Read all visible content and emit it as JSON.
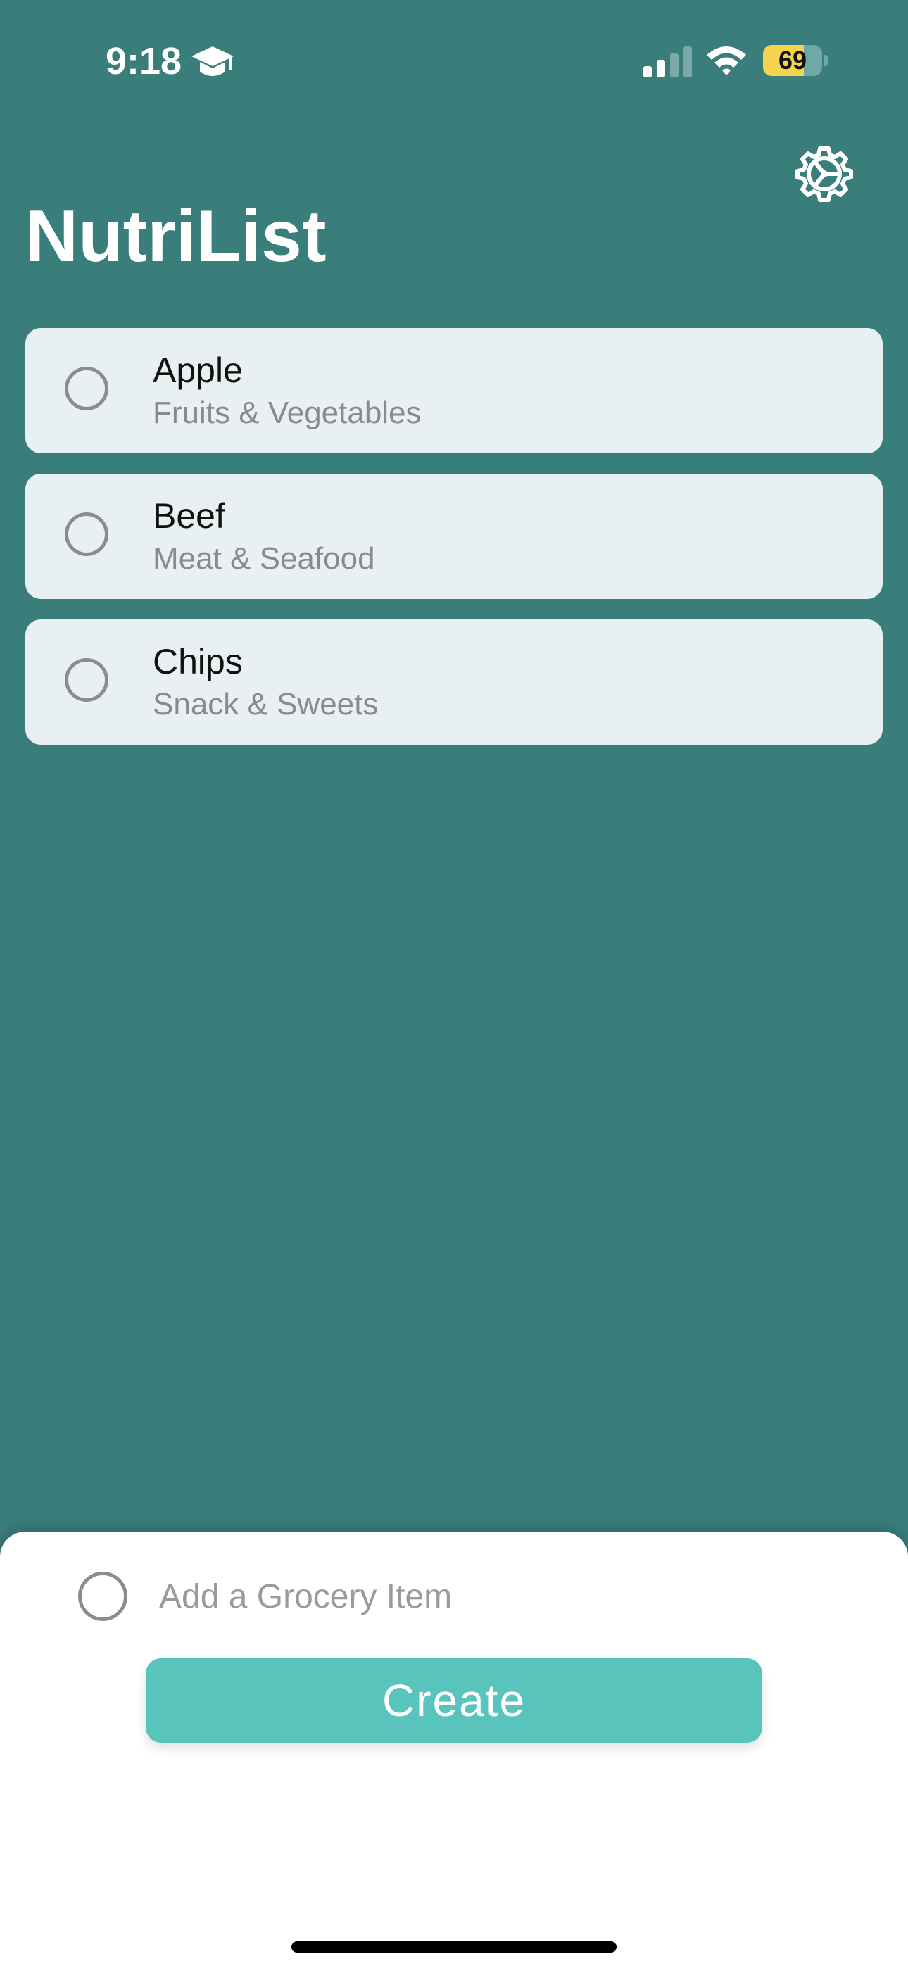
{
  "status_bar": {
    "time": "9:18",
    "focus_icon": "graduation-cap-icon",
    "signal_icon": "cellular-signal-icon",
    "wifi_icon": "wifi-icon",
    "battery_percent": "69",
    "battery_level": 0.69,
    "battery_color": "#f5d34f"
  },
  "header": {
    "title": "NutriList",
    "settings_icon": "gear-icon"
  },
  "grocery_items": [
    {
      "name": "Apple",
      "category": "Fruits & Vegetables"
    },
    {
      "name": "Beef",
      "category": "Meat & Seafood"
    },
    {
      "name": "Chips",
      "category": "Snack & Sweets"
    }
  ],
  "add_item": {
    "placeholder": "Add a Grocery Item",
    "value": "",
    "create_label": "Create"
  },
  "colors": {
    "background": "#3a7e7c",
    "accent": "#58c4bc",
    "card": "#e8f0f1"
  }
}
